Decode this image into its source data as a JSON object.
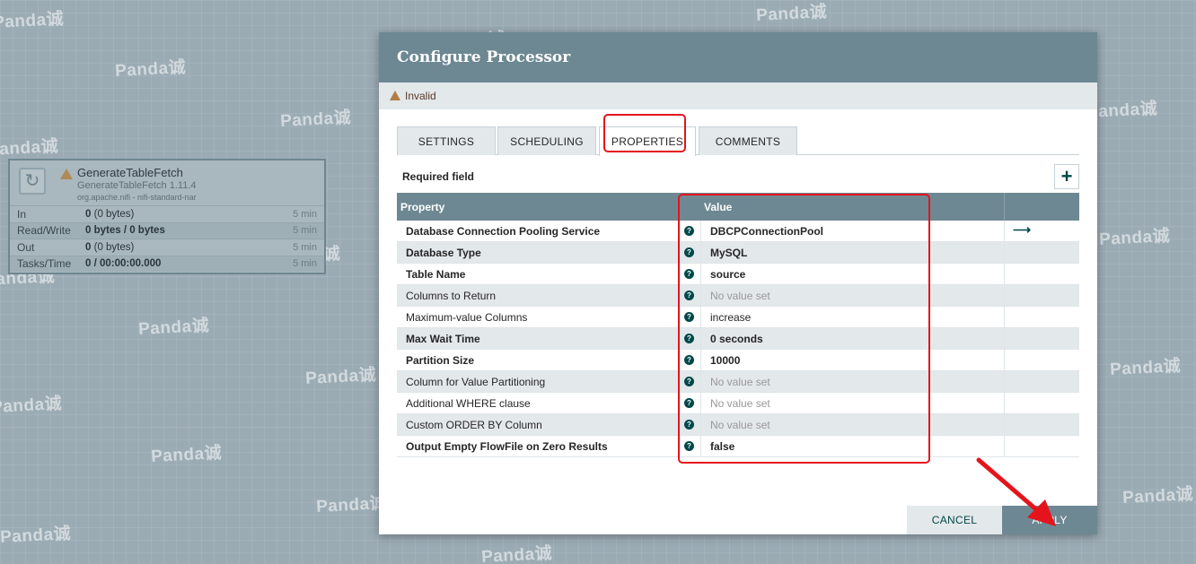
{
  "watermark_text": "Panda诚",
  "processor": {
    "name": "GenerateTableFetch",
    "type": "GenerateTableFetch 1.11.4",
    "bundle": "org.apache.nifi - nifi-standard-nar",
    "stats": [
      {
        "label": "In",
        "value": "0",
        "detail": "(0 bytes)",
        "window": "5 min"
      },
      {
        "label": "Read/Write",
        "value": "0 bytes / 0 bytes",
        "detail": "",
        "window": "5 min"
      },
      {
        "label": "Out",
        "value": "0",
        "detail": "(0 bytes)",
        "window": "5 min"
      },
      {
        "label": "Tasks/Time",
        "value": "0 / 00:00:00.000",
        "detail": "",
        "window": "5 min"
      }
    ]
  },
  "dialog": {
    "title": "Configure Processor",
    "status": "Invalid",
    "tabs": [
      "SETTINGS",
      "SCHEDULING",
      "PROPERTIES",
      "COMMENTS"
    ],
    "active_tab": "PROPERTIES",
    "required_field_label": "Required field",
    "add_button": "+",
    "table": {
      "col_property": "Property",
      "col_value": "Value",
      "rows": [
        {
          "name": "Database Connection Pooling Service",
          "value": "DBCPConnectionPool",
          "required": true,
          "set": true,
          "goto": true
        },
        {
          "name": "Database Type",
          "value": "MySQL",
          "required": true,
          "set": true,
          "goto": false
        },
        {
          "name": "Table Name",
          "value": "source",
          "required": true,
          "set": true,
          "goto": false
        },
        {
          "name": "Columns to Return",
          "value": "No value set",
          "required": false,
          "set": false,
          "goto": false
        },
        {
          "name": "Maximum-value Columns",
          "value": "increase",
          "required": false,
          "set": true,
          "goto": false
        },
        {
          "name": "Max Wait Time",
          "value": "0 seconds",
          "required": true,
          "set": true,
          "goto": false
        },
        {
          "name": "Partition Size",
          "value": "10000",
          "required": true,
          "set": true,
          "goto": false
        },
        {
          "name": "Column for Value Partitioning",
          "value": "No value set",
          "required": false,
          "set": false,
          "goto": false
        },
        {
          "name": "Additional WHERE clause",
          "value": "No value set",
          "required": false,
          "set": false,
          "goto": false
        },
        {
          "name": "Custom ORDER BY Column",
          "value": "No value set",
          "required": false,
          "set": false,
          "goto": false
        },
        {
          "name": "Output Empty FlowFile on Zero Results",
          "value": "false",
          "required": true,
          "set": true,
          "goto": false
        }
      ]
    },
    "cancel_label": "CANCEL",
    "apply_label": "APPLY"
  },
  "colors": {
    "header_bg": "#6d8893",
    "accent": "#004849",
    "annotation": "#e5141c",
    "warning": "#b07d45"
  }
}
